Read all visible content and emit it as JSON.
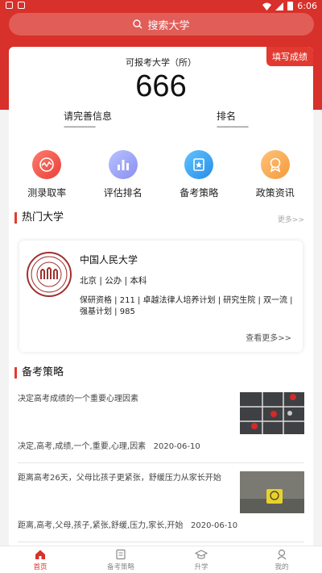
{
  "status_bar": {
    "time": "6:06"
  },
  "search": {
    "placeholder": "搜索大学"
  },
  "score_card": {
    "title": "可报考大学（所）",
    "count": "666",
    "fill_button": "填写成绩",
    "info_left_label": "请完善信息",
    "info_left_value": "---------------",
    "info_right_label": "排名",
    "info_right_value": "---------------"
  },
  "quick_actions": [
    {
      "label": "测录取率",
      "icon": "chart-wave-icon",
      "color": "#f2584a"
    },
    {
      "label": "评估排名",
      "icon": "bar-chart-icon",
      "color": "#9aa6f5"
    },
    {
      "label": "备考策略",
      "icon": "book-star-icon",
      "color": "#3ca4f0"
    },
    {
      "label": "政策资讯",
      "icon": "medal-icon",
      "color": "#f5a24a"
    }
  ],
  "hot_unis": {
    "title": "热门大学",
    "more": "更多>>",
    "card": {
      "name": "中国人民大学",
      "meta": "北京 | 公办 | 本科",
      "tags": "保研资格 | 211 | 卓越法律人培养计划 | 研究生院 | 双一流 | 强基计划 | 985",
      "more": "查看更多>>"
    }
  },
  "strategy": {
    "title": "备考策略",
    "articles": [
      {
        "title": "决定高考成绩的一个重要心理因素",
        "tags": "决定,高考,成绩,一个,重要,心理,因素",
        "date": "2020-06-10"
      },
      {
        "title": "距离高考26天，父母比孩子更紧张，舒缓压力从家长开始",
        "tags": "距离,高考,父母,孩子,紧张,舒缓,压力,家长,开始",
        "date": "2020-06-10"
      }
    ]
  },
  "bottom_nav": [
    {
      "label": "首页",
      "active": true
    },
    {
      "label": "备考策略",
      "active": false
    },
    {
      "label": "升学",
      "active": false
    },
    {
      "label": "我的",
      "active": false
    }
  ],
  "colors": {
    "brand_red": "#d8302a"
  }
}
